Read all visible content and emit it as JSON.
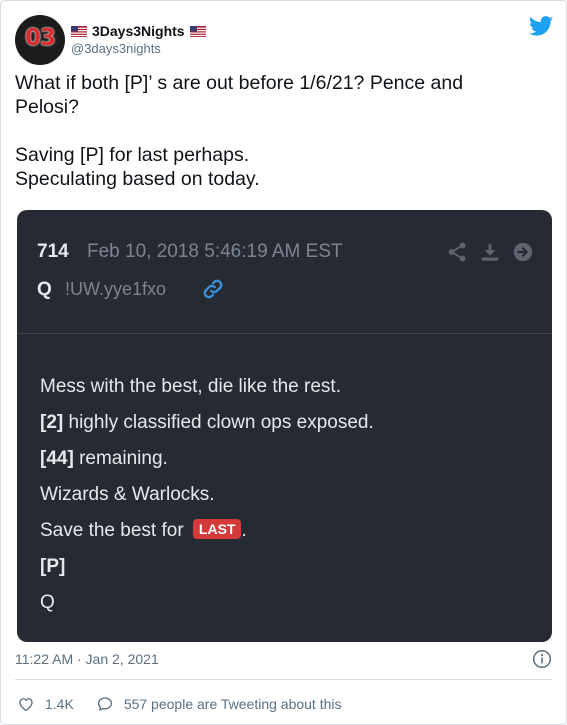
{
  "colors": {
    "twitter_blue": "#1da1f2",
    "card_background": "#262a33",
    "badge_red": "#d43a3a",
    "secondary_text": "#5b7083"
  },
  "author": {
    "avatar_text": "03",
    "display_name": "3Days3Nights",
    "handle": "@3days3nights",
    "name_icons": [
      "us-flag-icon",
      "us-flag-icon"
    ]
  },
  "tweet": {
    "lines": [
      "What if both [P]’ s are out before 1/6/21? Pence and",
      "Pelosi?",
      "",
      "Saving [P] for last perhaps.",
      "Speculating based on today."
    ],
    "timestamp": "11:22 AM · Jan 2, 2021",
    "likes": "1.4K",
    "conversation": "557 people are Tweeting about this"
  },
  "embedded_post": {
    "number": "714",
    "date": "Feb 10, 2018 5:46:19 AM EST",
    "author": "Q",
    "tripcode": "!UW.yye1fxo",
    "action_icons": [
      "share-icon",
      "download-icon",
      "arrow-right-circle-icon"
    ],
    "body": {
      "line1": "Mess with the best, die like the rest.",
      "line2_tag": "[2]",
      "line2_text": " highly classified clown ops exposed.",
      "line3_tag": "[44]",
      "line3_text": " remaining.",
      "line4": "Wizards & Warlocks.",
      "line5_text": "Save the best for ",
      "line5_badge": "LAST",
      "line5_end": ".",
      "line6": "[P]",
      "line7": "Q"
    }
  }
}
